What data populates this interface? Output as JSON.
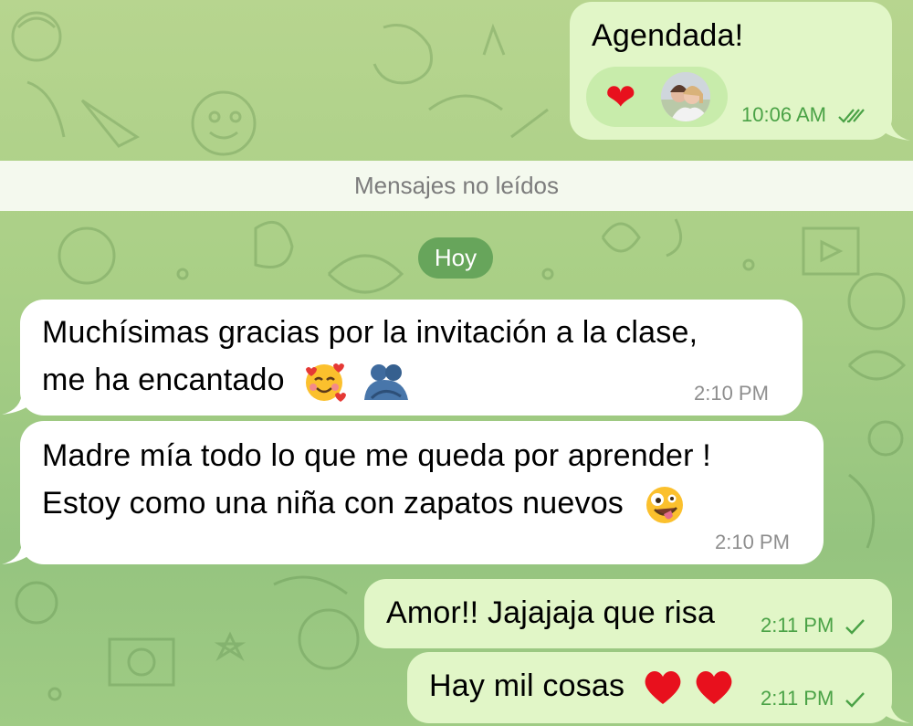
{
  "messages": [
    {
      "id": "m1",
      "direction": "outgoing",
      "text": "Agendada!",
      "time": "10:06 AM",
      "status": "read",
      "reactions": [
        "heart-emoji",
        "avatar"
      ]
    },
    {
      "id": "m2",
      "direction": "incoming",
      "lines": [
        "Muchísimas gracias por la invitación a la clase,",
        "me ha encantado"
      ],
      "emojis": [
        "smiling-face-with-hearts-emoji",
        "people-hugging-emoji"
      ],
      "time": "2:10 PM"
    },
    {
      "id": "m3",
      "direction": "incoming",
      "lines": [
        "Madre mía todo lo que me queda por aprender !",
        "Estoy como una niña con zapatos nuevos"
      ],
      "emojis": [
        "zany-face-emoji"
      ],
      "time": "2:10 PM"
    },
    {
      "id": "m4",
      "direction": "outgoing",
      "text": "Amor!! Jajajaja que risa",
      "time": "2:11 PM",
      "status": "sent"
    },
    {
      "id": "m5",
      "direction": "outgoing",
      "text": "Hay mil cosas",
      "emojis": [
        "red-heart-emoji",
        "red-heart-emoji"
      ],
      "time": "2:11 PM",
      "status": "sent"
    }
  ],
  "unread_banner": "Mensajes no leídos",
  "date_separator": "Hoy",
  "colors": {
    "outgoing_bubble": "#e1f6c7",
    "incoming_bubble": "#ffffff",
    "outgoing_time": "#4aa246",
    "incoming_time": "#8e8e8e",
    "date_pill": "#67a55b",
    "heart": "#e8101d",
    "wallpaper": "#a9cf86"
  }
}
